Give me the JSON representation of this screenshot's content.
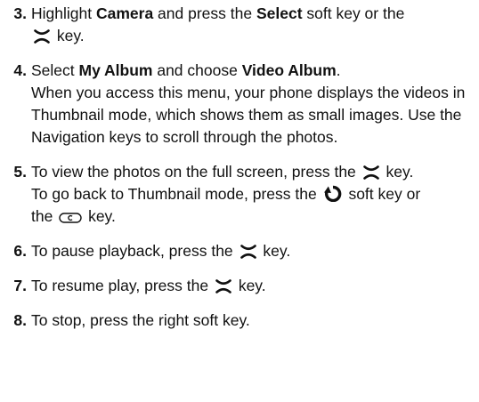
{
  "icons": {
    "ok_key": "x-shaped-ok-key-icon",
    "back_softkey": "circular-back-arrow-icon",
    "clear_key": "c-clear-key-icon"
  },
  "steps": [
    {
      "num": "3.",
      "t1": "Highlight ",
      "b1": "Camera",
      "t2": " and press the ",
      "b2": "Select",
      "t3": " soft key or the",
      "t4": " key."
    },
    {
      "num": "4.",
      "t1": "Select ",
      "b1": "My Album",
      "t2": " and choose ",
      "b2": "Video Album",
      "t3": ".",
      "t4": "When you access this menu, your phone displays the videos in Thumbnail mode, which shows them as small images. Use the Navigation keys to scroll through the photos."
    },
    {
      "num": "5.",
      "t1": "To view the photos on the full screen, press the",
      "t2": " key.",
      "t3": "To go back to Thumbnail mode, press the",
      "t4": " soft key or",
      "t5": "the",
      "t6": " key."
    },
    {
      "num": "6.",
      "t1": "To pause playback, press the",
      "t2": " key."
    },
    {
      "num": "7.",
      "t1": "To resume play, press the",
      "t2": " key."
    },
    {
      "num": "8.",
      "t1": "To stop, press the right soft key."
    }
  ]
}
